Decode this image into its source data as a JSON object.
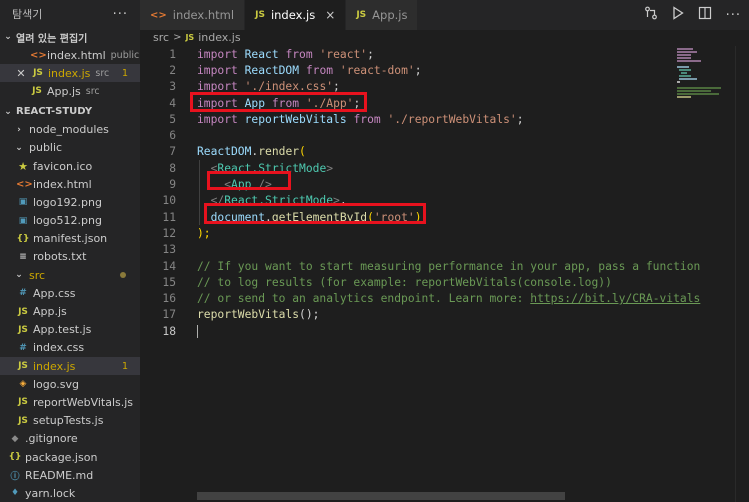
{
  "sidebar": {
    "title": "탐색기",
    "more": "···",
    "open_editors": {
      "header": "열려 있는 편집기",
      "items": [
        {
          "icon": "<>",
          "name": "index.html",
          "desc": "public"
        },
        {
          "icon": "JS",
          "name": "index.js",
          "desc": "src",
          "badge": "1"
        },
        {
          "icon": "JS",
          "name": "App.js",
          "desc": "src"
        }
      ]
    },
    "project": {
      "header": "REACT-STUDY",
      "items": [
        {
          "name": "node_modules"
        },
        {
          "name": "public"
        },
        {
          "icon": "★",
          "name": "favicon.ico"
        },
        {
          "icon": "<>",
          "name": "index.html"
        },
        {
          "icon": "▣",
          "name": "logo192.png"
        },
        {
          "icon": "▣",
          "name": "logo512.png"
        },
        {
          "icon": "{}",
          "name": "manifest.json"
        },
        {
          "icon": "≡",
          "name": "robots.txt"
        },
        {
          "name": "src"
        },
        {
          "icon": "#",
          "name": "App.css"
        },
        {
          "icon": "JS",
          "name": "App.js"
        },
        {
          "icon": "JS",
          "name": "App.test.js"
        },
        {
          "icon": "#",
          "name": "index.css"
        },
        {
          "icon": "JS",
          "name": "index.js",
          "badge": "1"
        },
        {
          "icon": "◈",
          "name": "logo.svg"
        },
        {
          "icon": "JS",
          "name": "reportWebVitals.js"
        },
        {
          "icon": "JS",
          "name": "setupTests.js"
        },
        {
          "icon": "◆",
          "name": ".gitignore"
        },
        {
          "icon": "{}",
          "name": "package.json"
        },
        {
          "icon": "ⓘ",
          "name": "README.md"
        },
        {
          "icon": "♦",
          "name": "yarn.lock"
        }
      ]
    }
  },
  "tabs": [
    {
      "icon": "<>",
      "label": "index.html"
    },
    {
      "icon": "JS",
      "label": "index.js",
      "close": "×"
    },
    {
      "icon": "JS",
      "label": "App.js"
    }
  ],
  "breadcrumb": {
    "folder": "src",
    "sep": ">",
    "icon": "JS",
    "file": "index.js"
  },
  "code": {
    "l1": {
      "a": "import",
      "b": "React",
      "c": "from",
      "d": "'react'",
      "e": ";"
    },
    "l2": {
      "a": "import",
      "b": "ReactDOM",
      "c": "from",
      "d": "'react-dom'",
      "e": ";"
    },
    "l3": {
      "a": "import",
      "d": "'./index.css'",
      "e": ";"
    },
    "l4": {
      "a": "import",
      "b": "App",
      "c": "from",
      "d": "'./App'",
      "e": ";"
    },
    "l5": {
      "a": "import",
      "b": "reportWebVitals",
      "c": "from",
      "d": "'./reportWebVitals'",
      "e": ";"
    },
    "l7": {
      "a": "ReactDOM",
      "b": ".",
      "c": "render",
      "d": "("
    },
    "l8": {
      "a": "<",
      "b": "React.StrictMode",
      "c": ">"
    },
    "l9": {
      "a": "<",
      "b": "App",
      "c": " />"
    },
    "l10": {
      "a": "</",
      "b": "React.StrictMode",
      "c": ">",
      "d": ","
    },
    "l11": {
      "a": "document",
      "b": ".",
      "c": "getElementById",
      "d": "(",
      "e": "'root'",
      "f": ")"
    },
    "l12": {
      "a": ");"
    },
    "l14": "// If you want to start measuring performance in your app, pass a function",
    "l15": "// to log results (for example: reportWebVitals(console.log))",
    "l16_pre": "// or send to an analytics endpoint. Learn more: ",
    "l16_url": "https://bit.ly/CRA-vitals",
    "l17": {
      "a": "reportWebVitals",
      "b": "();"
    },
    "line_numbers": [
      "1",
      "2",
      "3",
      "4",
      "5",
      "6",
      "7",
      "8",
      "9",
      "10",
      "11",
      "12",
      "13",
      "14",
      "15",
      "16",
      "17",
      "18"
    ]
  },
  "colors": {
    "highlight": "#e8121e",
    "accent": "#007acc"
  }
}
